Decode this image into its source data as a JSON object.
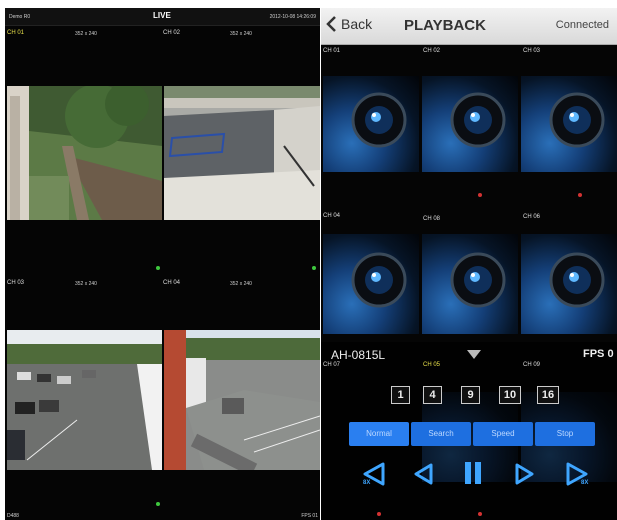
{
  "live": {
    "device": "Demo R0",
    "title": "LIVE",
    "timestamp": "2012-10-08 14:26:09",
    "tiles": [
      {
        "channel": "CH 01",
        "resolution": "352 x 240"
      },
      {
        "channel": "CH 02",
        "resolution": "352 x 240"
      },
      {
        "channel": "CH 03",
        "resolution": "352 x 240"
      },
      {
        "channel": "CH 04",
        "resolution": "352 x 240"
      }
    ],
    "bottom_left": "D488",
    "bottom_right": "FPS 01"
  },
  "playback": {
    "back_label": "Back",
    "title": "PLAYBACK",
    "status": "Connected",
    "channels": [
      "CH 01",
      "CH 02",
      "CH 03",
      "CH 04",
      "CH 08",
      "CH 06",
      "CH 07",
      "CH 05",
      "CH 09"
    ],
    "device": "AH-0815L",
    "fps_label": "FPS 0",
    "split_options": [
      "1",
      "4",
      "9",
      "10",
      "16"
    ],
    "modes": [
      "Normal",
      "Search",
      "Speed",
      "Stop"
    ],
    "controls": [
      "rewind-8x",
      "step-back",
      "pause",
      "play",
      "forward-8x"
    ],
    "speed_badge": "8X",
    "colors": {
      "accent": "#1e6fe0",
      "control": "#3fa6ff",
      "live_title": "#ffffff",
      "active_channel": "#e8e04a"
    }
  }
}
